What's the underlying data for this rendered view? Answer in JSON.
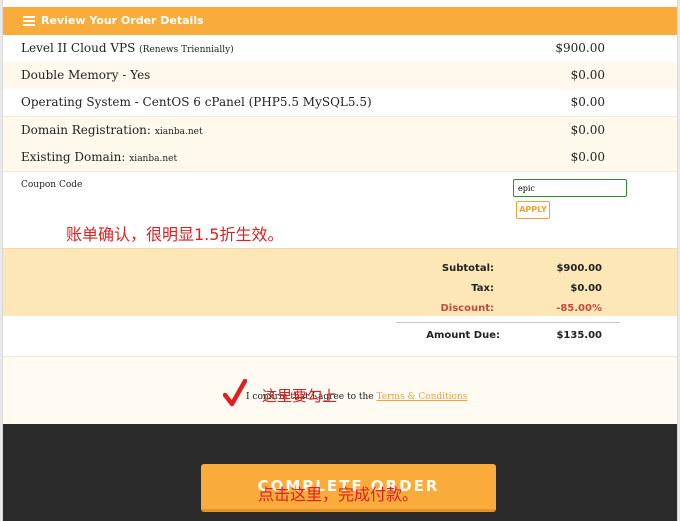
{
  "header": {
    "title": "Review Your Order Details",
    "icon": "list-icon"
  },
  "items": [
    {
      "desc_main": "Level II Cloud VPS",
      "desc_small": "(Renews Triennially)",
      "amount": "$900.00"
    },
    {
      "desc_main": "Double Memory - Yes",
      "desc_small": "",
      "amount": "$0.00"
    },
    {
      "desc_main": "Operating System - CentOS 6 cPanel (PHP5.5 MySQL5.5)",
      "desc_small": "",
      "amount": "$0.00"
    },
    {
      "desc_main": "Domain Registration:",
      "desc_small": "xianba.net",
      "amount": "$0.00"
    },
    {
      "desc_main": "Existing Domain:",
      "desc_small": "xianba.net",
      "amount": "$0.00"
    }
  ],
  "coupon": {
    "label": "Coupon Code",
    "value": "epic",
    "apply_label": "APPLY"
  },
  "totals": {
    "subtotal_label": "Subtotal:",
    "subtotal": "$900.00",
    "tax_label": "Tax:",
    "tax": "$0.00",
    "discount_label": "Discount:",
    "discount": "-85.00%",
    "due_label": "Amount Due:",
    "due": "$135.00"
  },
  "terms": {
    "prefix": "I confirm that I agree to the",
    "link": "Terms & Conditions"
  },
  "pay_button": {
    "label": "COMPLETE ORDER"
  },
  "annotations": {
    "bill_note": "账单确认，很明显1.5折生效。",
    "check_note": "这里要勾上",
    "pay_note": "点击这里，完成付款。"
  },
  "colors": {
    "accent": "#f9ab3c",
    "annotation": "#e02020",
    "discount": "#c44a3c",
    "footer": "#2b2b2b"
  }
}
